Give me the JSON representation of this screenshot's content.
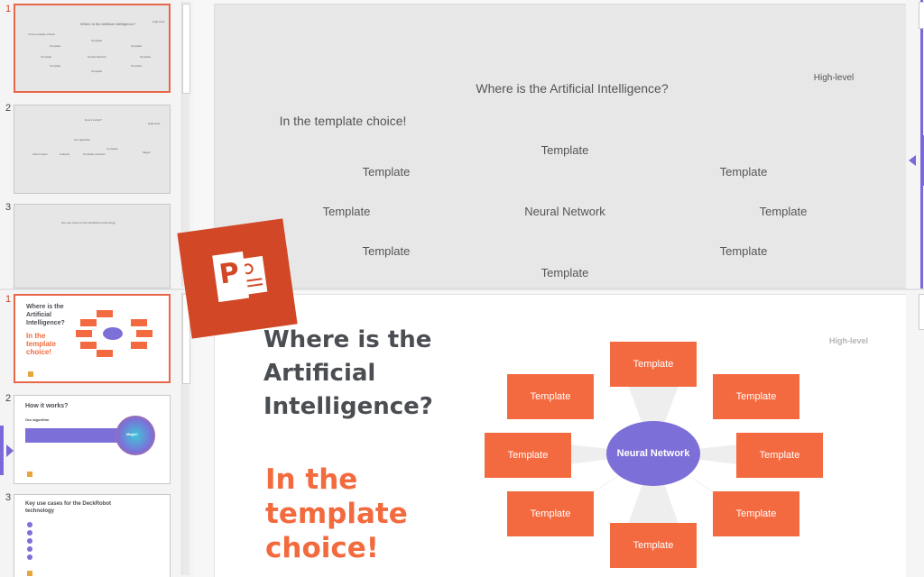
{
  "top_view": {
    "thumbnails": [
      {
        "number": "1",
        "active": true,
        "lines": [
          "Where is the Artificial Intelligence?",
          "High-level",
          "In the template choice!",
          "Template",
          "Template",
          "Template",
          "Template",
          "Neural Network",
          "Template",
          "Template",
          "Template",
          "Template"
        ]
      },
      {
        "number": "2",
        "active": false,
        "lines": [
          "How it works?",
          "High-level",
          "Our algorithm",
          "Client inputs",
          "Analysis",
          "Template selection",
          "Complete",
          "Magic!"
        ]
      },
      {
        "number": "3",
        "active": false,
        "lines": [
          "Key use cases for the DeckRobot technology"
        ]
      }
    ],
    "slide": {
      "title": "Where is the Artificial Intelligence?",
      "tag": "High-level",
      "subtitle": "In the template choice!",
      "center": "Neural Network",
      "template_label": "Template"
    }
  },
  "bottom_view": {
    "thumbnails": [
      {
        "number": "1",
        "active": true,
        "title": "Where is the Artificial Intelligence?",
        "subtitle": "In the template choice!"
      },
      {
        "number": "2",
        "active": false,
        "title": "How it works?",
        "subtitle": "Our algorithm",
        "badge": "Magic!"
      },
      {
        "number": "3",
        "active": false,
        "title": "Key use cases for the DeckRobot technology"
      }
    ],
    "slide": {
      "title": "Where is the Artificial Intelligence?",
      "subtitle": "In the template choice!",
      "tag": "High-level",
      "center": "Neural Network",
      "templates": [
        "Template",
        "Template",
        "Template",
        "Template",
        "Template",
        "Template",
        "Template",
        "Template"
      ]
    }
  },
  "logo": {
    "name": "PowerPoint",
    "letter": "P"
  },
  "colors": {
    "accent_orange": "#f46a40",
    "accent_purple": "#7c6fd8",
    "powerpoint_red": "#d24726"
  }
}
